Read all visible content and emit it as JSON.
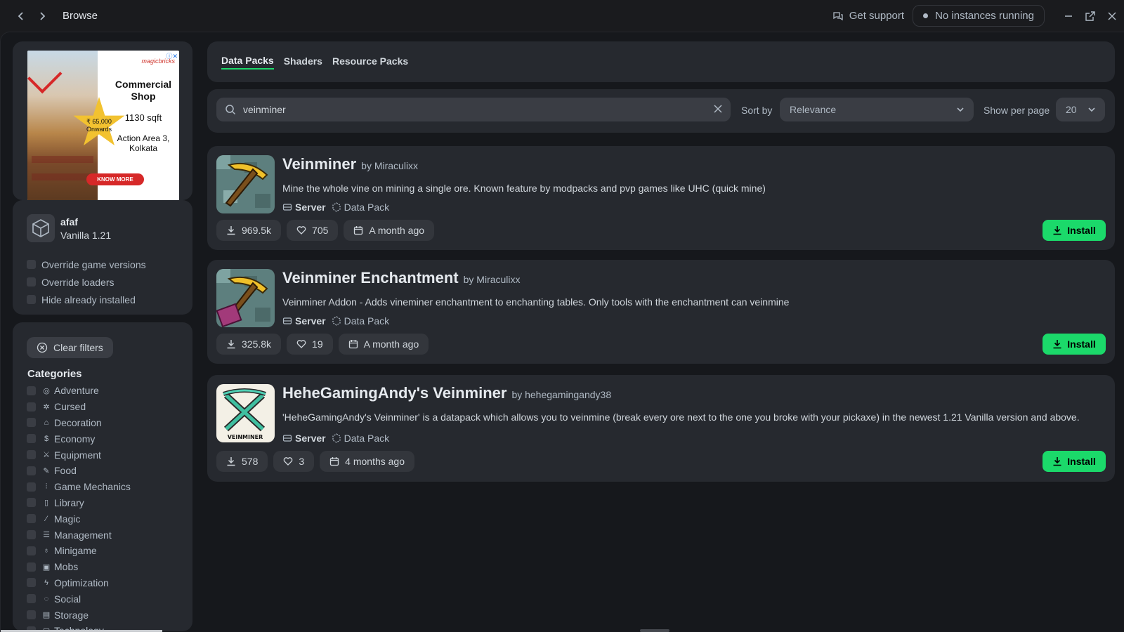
{
  "titlebar": {
    "crumb": "Browse",
    "get_support": "Get support",
    "instances": "No instances running"
  },
  "ad": {
    "brand": "magicbricks",
    "title": "Commercial Shop",
    "size": "1130 sqft",
    "price": "₹ 65,000 Onwards",
    "location": "Action Area 3, Kolkata",
    "cta": "KNOW MORE"
  },
  "instance": {
    "name": "afaf",
    "version": "Vanilla 1.21",
    "options": [
      "Override game versions",
      "Override loaders",
      "Hide already installed"
    ]
  },
  "filters": {
    "clear_label": "Clear filters",
    "categories_title": "Categories",
    "categories": [
      {
        "label": "Adventure",
        "icon": "compass-icon"
      },
      {
        "label": "Cursed",
        "icon": "bug-icon"
      },
      {
        "label": "Decoration",
        "icon": "house-icon"
      },
      {
        "label": "Economy",
        "icon": "dollar-icon"
      },
      {
        "label": "Equipment",
        "icon": "swords-icon"
      },
      {
        "label": "Food",
        "icon": "carrot-icon"
      },
      {
        "label": "Game Mechanics",
        "icon": "sliders-icon"
      },
      {
        "label": "Library",
        "icon": "book-icon"
      },
      {
        "label": "Magic",
        "icon": "wand-icon"
      },
      {
        "label": "Management",
        "icon": "server-icon"
      },
      {
        "label": "Minigame",
        "icon": "award-icon"
      },
      {
        "label": "Mobs",
        "icon": "mob-icon"
      },
      {
        "label": "Optimization",
        "icon": "bolt-icon"
      },
      {
        "label": "Social",
        "icon": "chat-icon"
      },
      {
        "label": "Storage",
        "icon": "archive-icon"
      },
      {
        "label": "Technology",
        "icon": "chip-icon"
      }
    ]
  },
  "tabs": [
    "Data Packs",
    "Shaders",
    "Resource Packs"
  ],
  "search": {
    "value": "veinminer",
    "sort_label": "Sort by",
    "sort_value": "Relevance",
    "per_page_label": "Show per page",
    "per_page_value": "20"
  },
  "results": [
    {
      "name": "Veinminer",
      "author": "by Miraculixx",
      "description": "Mine the whole vine on mining a single ore. Known feature by modpacks and pvp games like UHC (quick mine)",
      "env": "Server",
      "type": "Data Pack",
      "downloads": "969.5k",
      "likes": "705",
      "updated": "A month ago",
      "install": "Install"
    },
    {
      "name": "Veinminer Enchantment",
      "author": "by Miraculixx",
      "description": "Veinminer Addon - Adds vineminer enchantment to enchanting tables. Only tools with the enchantment can veinmine",
      "env": "Server",
      "type": "Data Pack",
      "downloads": "325.8k",
      "likes": "19",
      "updated": "A month ago",
      "install": "Install"
    },
    {
      "name": "HeheGamingAndy's Veinminer",
      "author": "by hehegamingandy38",
      "description": "'HeheGamingAndy's Veinminer' is a datapack which allows you to veinmine (break every ore next to the one you broke with your pickaxe) in the newest 1.21 Vanilla version and above.",
      "env": "Server",
      "type": "Data Pack",
      "downloads": "578",
      "likes": "3",
      "updated": "4 months ago",
      "install": "Install",
      "thumb_text": "VEINMINER"
    }
  ],
  "colors": {
    "accent": "#1bd96a",
    "card": "#26292f",
    "background": "#16181c"
  }
}
